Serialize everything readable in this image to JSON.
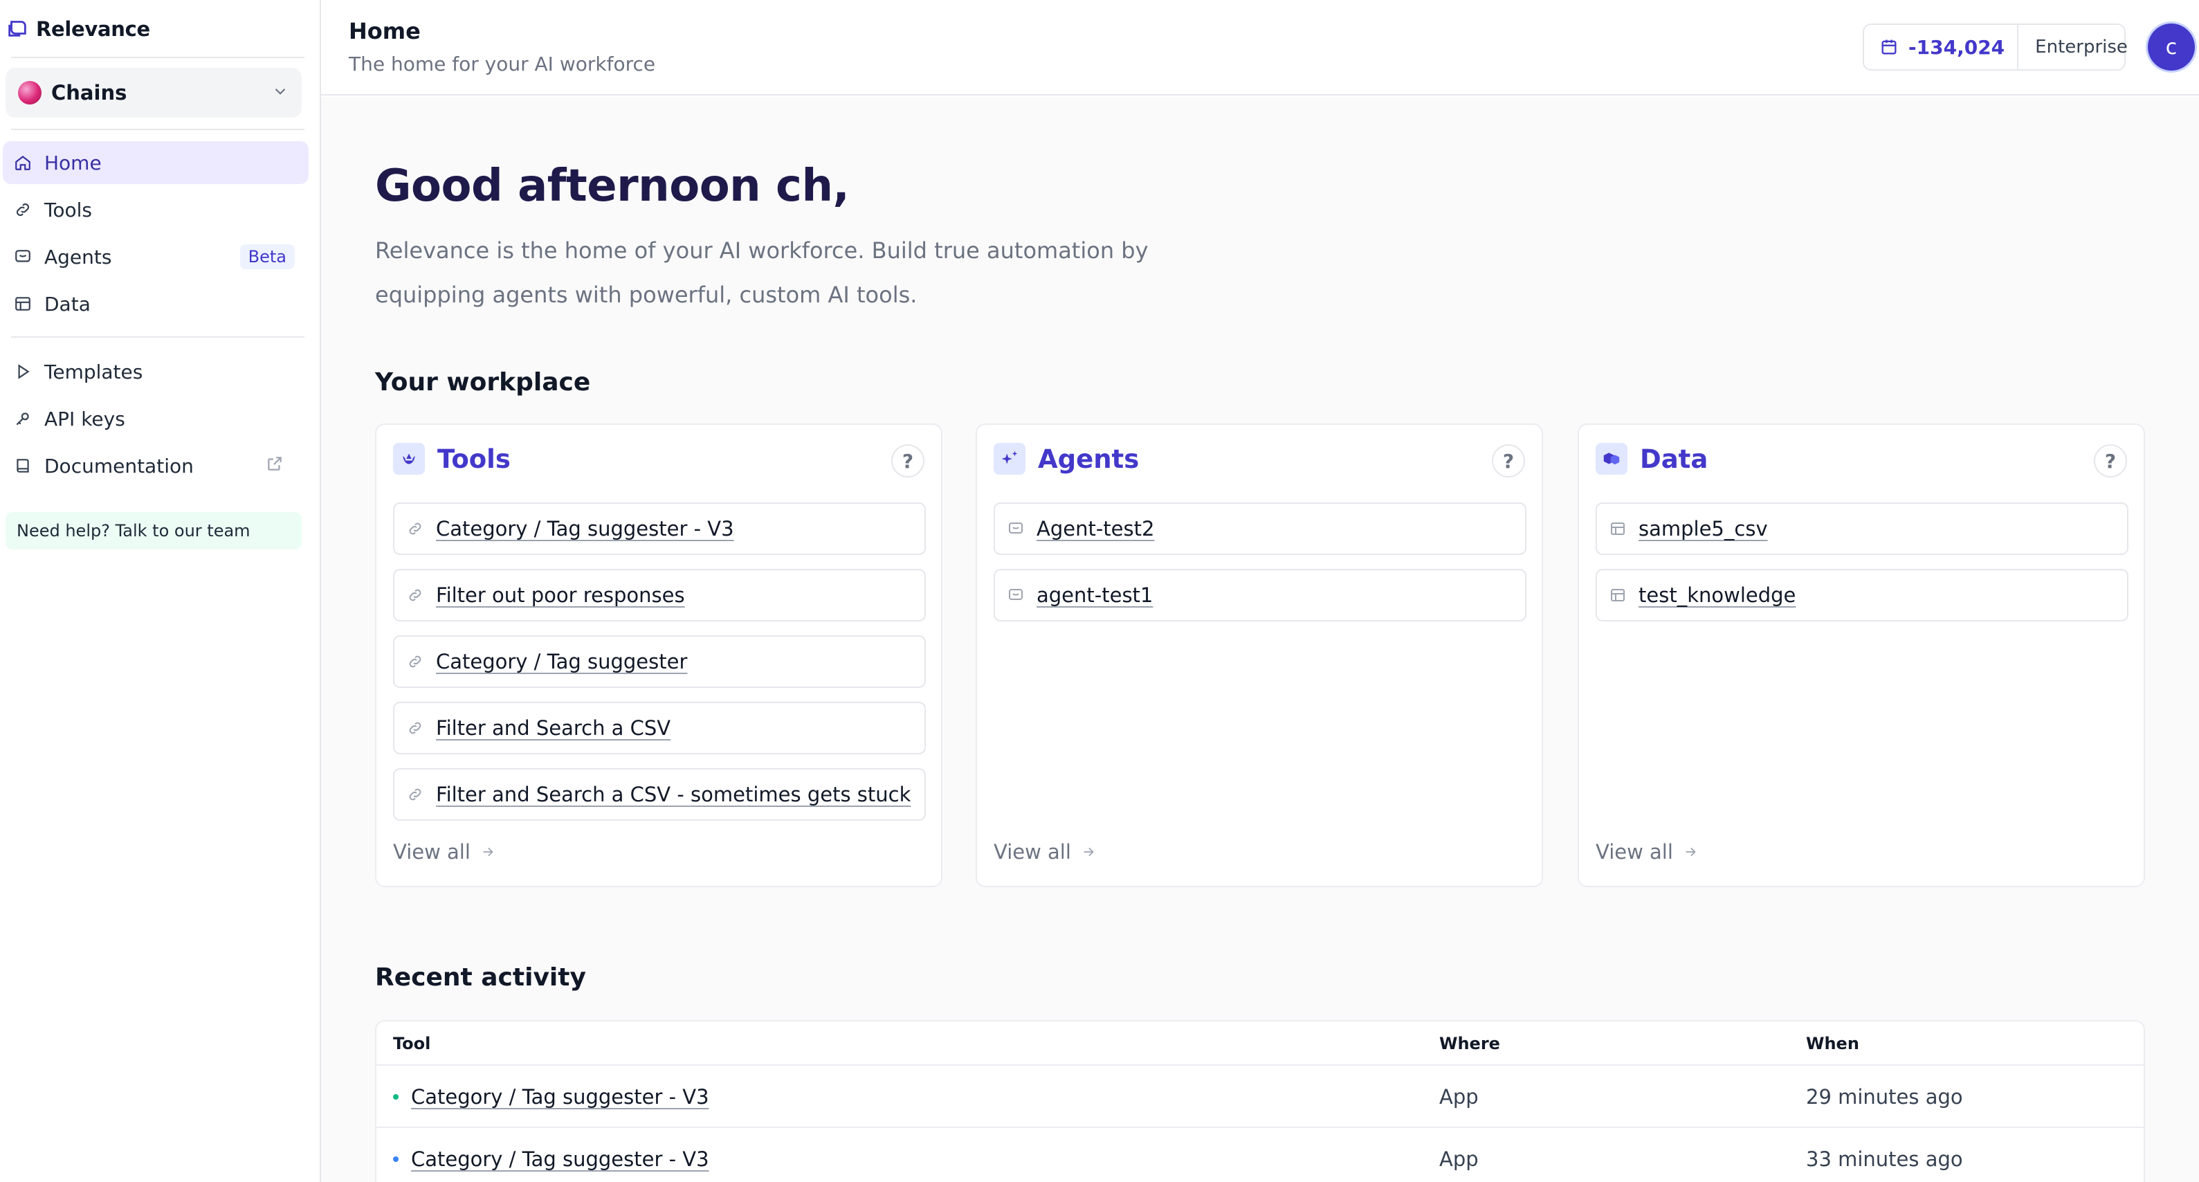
{
  "brand": {
    "name": "Relevance"
  },
  "workspace": {
    "name": "Chains"
  },
  "nav": {
    "primary": [
      {
        "label": "Home",
        "icon": "home-icon",
        "active": true
      },
      {
        "label": "Tools",
        "icon": "link-icon"
      },
      {
        "label": "Agents",
        "icon": "chat-icon",
        "badge": "Beta"
      },
      {
        "label": "Data",
        "icon": "table-icon"
      }
    ],
    "secondary": [
      {
        "label": "Templates",
        "icon": "play-icon"
      },
      {
        "label": "API keys",
        "icon": "key-icon"
      },
      {
        "label": "Documentation",
        "icon": "book-icon"
      }
    ],
    "help": "Need help? Talk to our team"
  },
  "header": {
    "title": "Home",
    "subtitle": "The home for your AI workforce",
    "credits": "-134,024",
    "plan": "Enterprise",
    "avatar": "c"
  },
  "main": {
    "greeting": "Good afternoon ch,",
    "intro": "Relevance is the home of your AI workforce. Build true automation by equipping agents with powerful, custom AI tools.",
    "workplace_title": "Your workplace",
    "help_mark": "?",
    "view_all": "View all",
    "cards": {
      "tools": {
        "title": "Tools",
        "items": [
          "Category / Tag suggester - V3",
          "Filter out poor responses",
          "Category / Tag suggester",
          "Filter and Search a CSV",
          "Filter and Search a CSV - sometimes gets stuck"
        ]
      },
      "agents": {
        "title": "Agents",
        "items": [
          "Agent-test2",
          "agent-test1"
        ]
      },
      "data": {
        "title": "Data",
        "items": [
          "sample5_csv",
          "test_knowledge"
        ]
      }
    },
    "recent": {
      "title": "Recent activity",
      "columns": {
        "tool": "Tool",
        "where": "Where",
        "when": "When"
      },
      "rows": [
        {
          "tool": "Category / Tag suggester - V3",
          "where": "App",
          "when": "29 minutes ago"
        },
        {
          "tool": "Category / Tag suggester - V3",
          "where": "App",
          "when": "33 minutes ago"
        }
      ]
    }
  },
  "colors": {
    "accent": "#4338ca",
    "active_bg": "#ede9fe",
    "help_bg": "#ecfdf5",
    "dot_green": "#10b981",
    "dot_blue": "#3b82f6"
  }
}
